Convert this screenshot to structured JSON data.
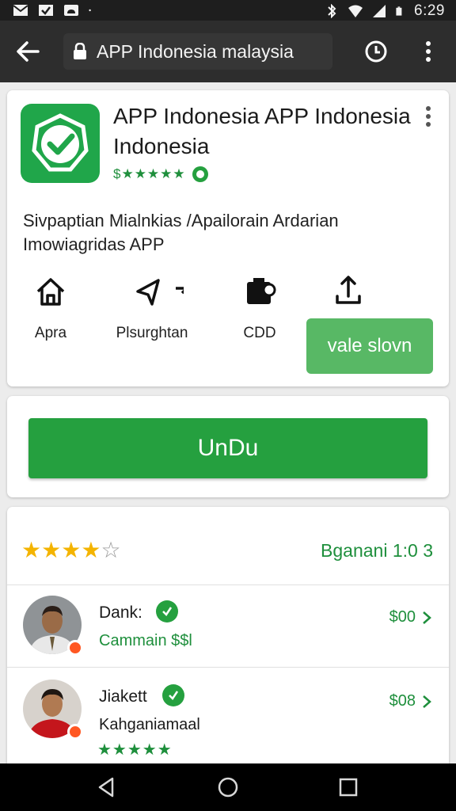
{
  "status_bar": {
    "time": "6:29",
    "icons": [
      "mail-icon",
      "check-icon",
      "cloud-icon",
      "dot-icon",
      "bluetooth-icon",
      "wifi-icon",
      "signal-icon",
      "battery-icon"
    ]
  },
  "toolbar": {
    "url": "APP Indonesia malaysia",
    "icons": [
      "back-arrow-icon",
      "lock-icon",
      "clock-icon",
      "more-vert-icon"
    ]
  },
  "app": {
    "title": "APP Indonesia APP Indonesia Indonesia",
    "rating_stars": "$★★★★★",
    "description": "Sivpaptian Mialnkias /Apailorain Ardarian Imowiagridas APP",
    "features": [
      {
        "label": "Apra",
        "icon": "home-icon"
      },
      {
        "label": "Plsurghtan",
        "icon": "send-icon"
      },
      {
        "label": "CDD",
        "icon": "wallet-icon"
      },
      {
        "label": "",
        "icon": "upload-icon"
      }
    ],
    "secondary_button": "vale slovn",
    "logo_color": "#20a64a"
  },
  "install": {
    "label": "UnDu",
    "color": "#25a03f"
  },
  "reviews": {
    "summary_rating": 4,
    "summary_max": 5,
    "summary_text": "Bganani 1:0 3",
    "items": [
      {
        "name": "Dank:",
        "subtitle": "Cammain $$l",
        "stars": "",
        "price": "$00"
      },
      {
        "name": "Jiakett",
        "subtitle": "Kahganiamaal",
        "stars": "★★★★★",
        "price": "$08"
      }
    ]
  },
  "colors": {
    "accent_green": "#25a03f",
    "light_green": "#58b865",
    "star_yellow": "#f4b400",
    "toolbar": "#2d2d2d"
  }
}
